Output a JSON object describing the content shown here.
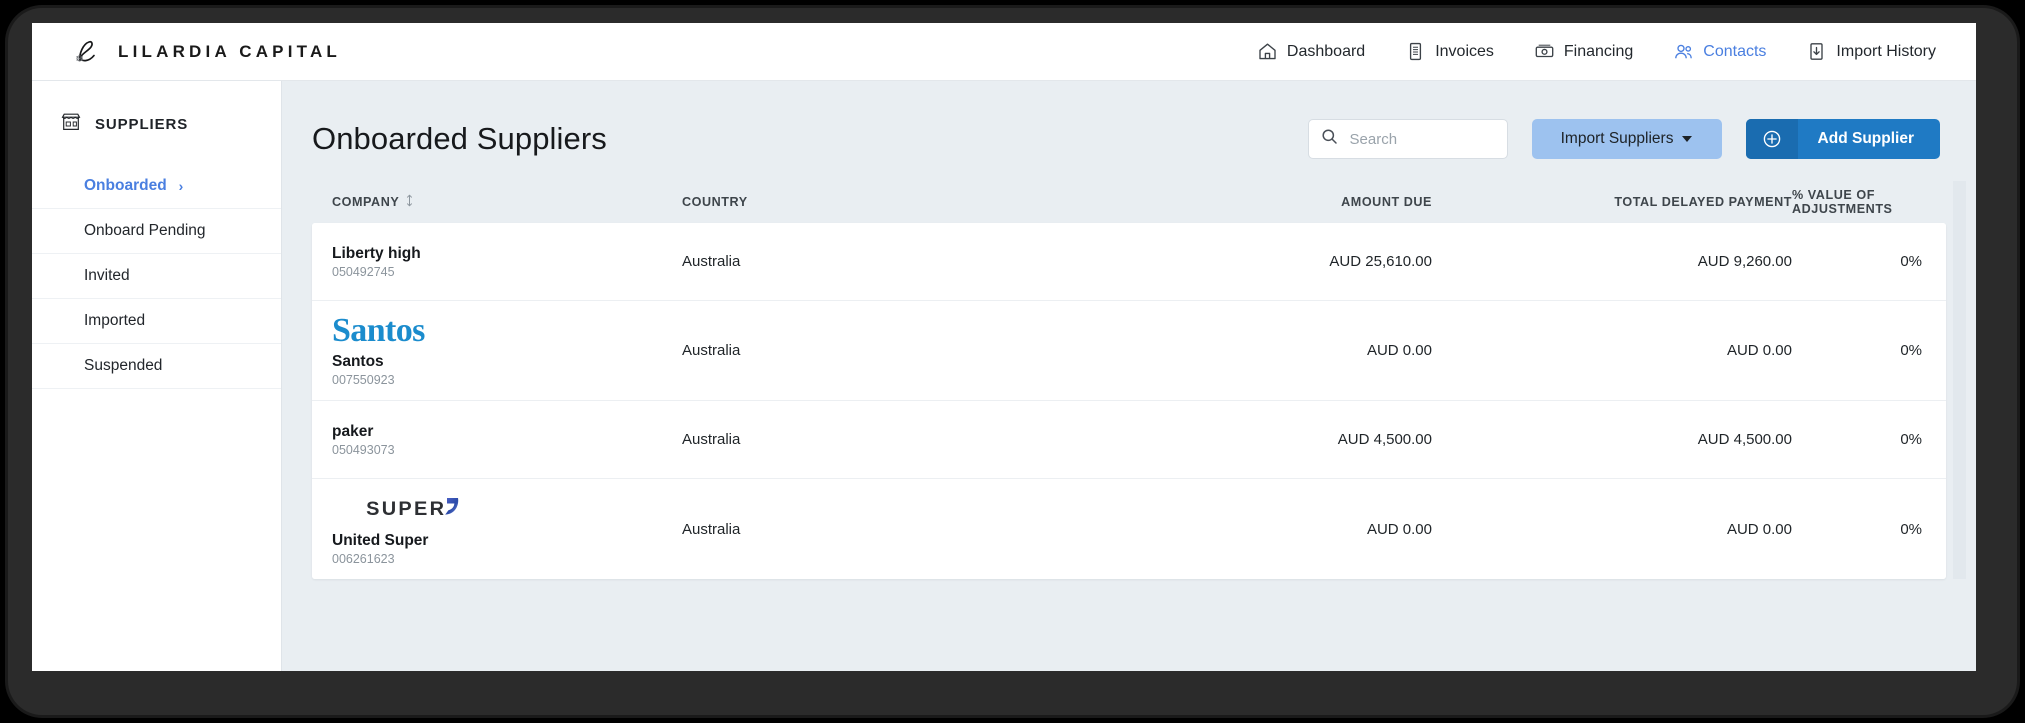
{
  "brand": {
    "monogram_icon": "lilardia-script-l-logo",
    "name": "LILARDIA CAPITAL"
  },
  "topnav": {
    "items": [
      {
        "label": "Dashboard",
        "icon": "home-icon",
        "active": false
      },
      {
        "label": "Invoices",
        "icon": "document-icon",
        "active": false
      },
      {
        "label": "Financing",
        "icon": "banknote-icon",
        "active": false
      },
      {
        "label": "Contacts",
        "icon": "people-icon",
        "active": true
      },
      {
        "label": "Import History",
        "icon": "import-download-icon",
        "active": false
      }
    ],
    "active_color": "#4a7fe0"
  },
  "sidebar": {
    "heading": "SUPPLIERS",
    "heading_icon": "storefront-icon",
    "items": [
      {
        "label": "Onboarded",
        "active": true,
        "chevron": "›"
      },
      {
        "label": "Onboard Pending",
        "active": false,
        "chevron": ""
      },
      {
        "label": "Invited",
        "active": false,
        "chevron": ""
      },
      {
        "label": "Imported",
        "active": false,
        "chevron": ""
      },
      {
        "label": "Suspended",
        "active": false,
        "chevron": ""
      }
    ]
  },
  "main": {
    "page_title": "Onboarded Suppliers",
    "search": {
      "placeholder": "Search",
      "value": "",
      "icon": "search-icon"
    },
    "import_suppliers_button": {
      "label": "Import Suppliers",
      "icon": "chevron-down-icon",
      "color": "#9dc2ef"
    },
    "add_supplier_button": {
      "label": "Add Supplier",
      "icon": "plus-circle-icon",
      "color": "#1f7ac4"
    }
  },
  "table": {
    "columns": [
      {
        "label": "COMPANY",
        "sort_icon": "sort-arrows-icon"
      },
      {
        "label": "COUNTRY",
        "sort_icon": ""
      },
      {
        "label": "AMOUNT DUE",
        "sort_icon": ""
      },
      {
        "label": "TOTAL DELAYED PAYMENT",
        "sort_icon": ""
      },
      {
        "label": "% VALUE OF ADJUSTMENTS",
        "sort_icon": ""
      }
    ],
    "rows": [
      {
        "logo": "",
        "logo_type": "none",
        "company": "Liberty high",
        "company_id": "050492745",
        "country": "Australia",
        "amount_due": "AUD 25,610.00",
        "total_delayed_payment": "AUD 9,260.00",
        "pct_value_adjustments": "0%"
      },
      {
        "logo": "Santos",
        "logo_type": "santos-wordmark",
        "company": "Santos",
        "company_id": "007550923",
        "country": "Australia",
        "amount_due": "AUD 0.00",
        "total_delayed_payment": "AUD 0.00",
        "pct_value_adjustments": "0%"
      },
      {
        "logo": "",
        "logo_type": "none",
        "company": "paker",
        "company_id": "050493073",
        "country": "Australia",
        "amount_due": "AUD 4,500.00",
        "total_delayed_payment": "AUD 4,500.00",
        "pct_value_adjustments": "0%"
      },
      {
        "logo": "SUPER",
        "logo_type": "super-wordmark",
        "company": "United Super",
        "company_id": "006261623",
        "country": "Australia",
        "amount_due": "AUD 0.00",
        "total_delayed_payment": "AUD 0.00",
        "pct_value_adjustments": "0%"
      }
    ]
  }
}
